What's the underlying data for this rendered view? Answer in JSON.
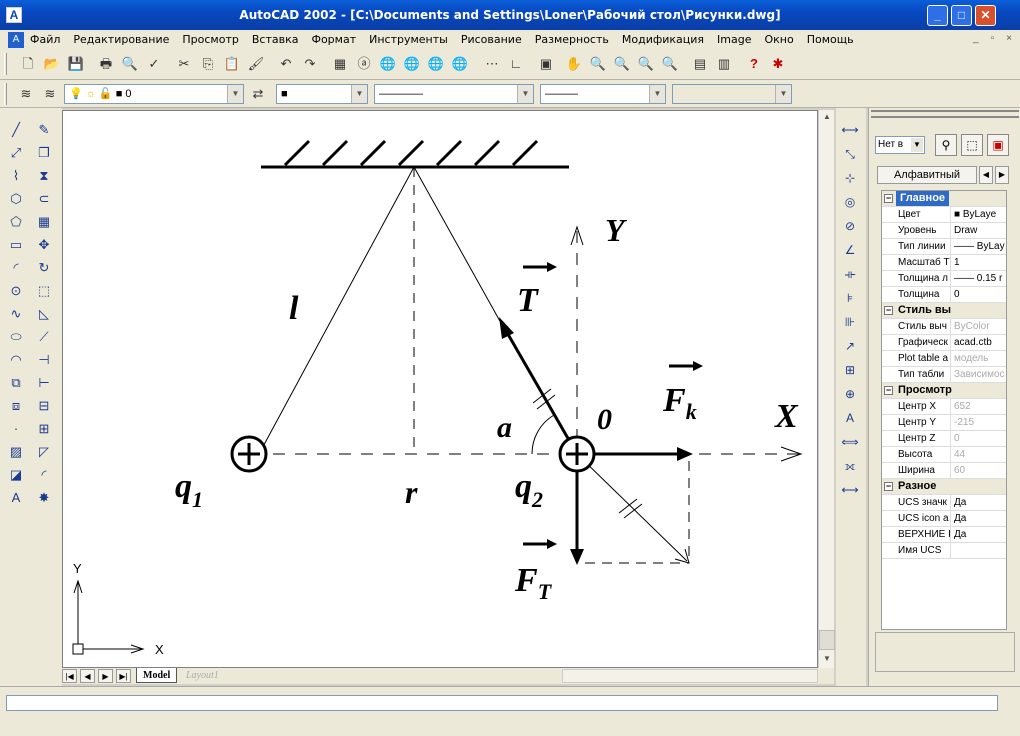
{
  "window": {
    "title": "AutoCAD 2002 - [C:\\Documents and Settings\\Loner\\Рабочий стол\\Рисунки.dwg]",
    "buttons": [
      "_",
      "□",
      "✕"
    ]
  },
  "menu": {
    "items": [
      "Файл",
      "Редактирование",
      "Просмотр",
      "Вставка",
      "Формат",
      "Инструменты",
      "Рисование",
      "Размерность",
      "Модификация",
      "Image",
      "Окно",
      "Помощь"
    ],
    "mdi_buttons": [
      "_",
      "▫",
      "×"
    ]
  },
  "layers_toolbar": {
    "layer_value": "0",
    "color_value": "",
    "linetype_value": "————",
    "lineweight_value": "———"
  },
  "drawing": {
    "labels": {
      "rod_length": "l",
      "tension": "T",
      "force_k": "F",
      "force_k_sub": "k",
      "force_g": "F",
      "force_g_sub": "T",
      "axis_x": "X",
      "axis_y": "Y",
      "origin": "0",
      "angle": "a",
      "charge1": "q",
      "charge1_sub": "1",
      "charge2": "q",
      "charge2_sub": "2",
      "distance": "r"
    },
    "ucs": {
      "x": "X",
      "y": "Y"
    }
  },
  "layout_tabs": {
    "nav": [
      "|◀",
      "◀",
      "▶",
      "▶|"
    ],
    "tabs": [
      "Model",
      "Layout1"
    ]
  },
  "properties": {
    "selection": "Нет в",
    "tab": "Алфавитный",
    "sections": [
      {
        "name": "Главное",
        "rows": [
          {
            "k": "Цвет",
            "v": "■ ByLaye",
            "dim": false
          },
          {
            "k": "Уровень",
            "v": "Draw",
            "dim": false
          },
          {
            "k": "Тип линии",
            "v": "—— ByLay",
            "dim": false
          },
          {
            "k": "Масштаб Т",
            "v": "1",
            "dim": false
          },
          {
            "k": "Толщина л",
            "v": "—— 0.15 r",
            "dim": false
          },
          {
            "k": "Толщина",
            "v": "0",
            "dim": false
          }
        ]
      },
      {
        "name": "Стиль вы",
        "rows": [
          {
            "k": "Стиль выч",
            "v": "ByColor",
            "dim": true
          },
          {
            "k": "Графическ",
            "v": "acad.ctb",
            "dim": false
          },
          {
            "k": "Plot table a",
            "v": "модель",
            "dim": true
          },
          {
            "k": "Тип табли",
            "v": "Зависимос",
            "dim": true
          }
        ]
      },
      {
        "name": "Просмотр",
        "rows": [
          {
            "k": "Центр X",
            "v": "652",
            "dim": true
          },
          {
            "k": "Центр Y",
            "v": "-215",
            "dim": true
          },
          {
            "k": "Центр Z",
            "v": "0",
            "dim": true
          },
          {
            "k": "Высота",
            "v": "44",
            "dim": true
          },
          {
            "k": "Ширина",
            "v": "60",
            "dim": true
          }
        ]
      },
      {
        "name": "Разное",
        "rows": [
          {
            "k": "UCS значк",
            "v": "Да",
            "dim": false
          },
          {
            "k": "UCS icon a",
            "v": "Да",
            "dim": false
          },
          {
            "k": "ВЕРХНИЕ Р",
            "v": "Да",
            "dim": false
          },
          {
            "k": "Имя UCS",
            "v": "",
            "dim": false
          }
        ]
      }
    ]
  },
  "colors": {
    "titlebar": "#0848c0",
    "selection": "#316ac5",
    "canvas": "#ffffff"
  }
}
